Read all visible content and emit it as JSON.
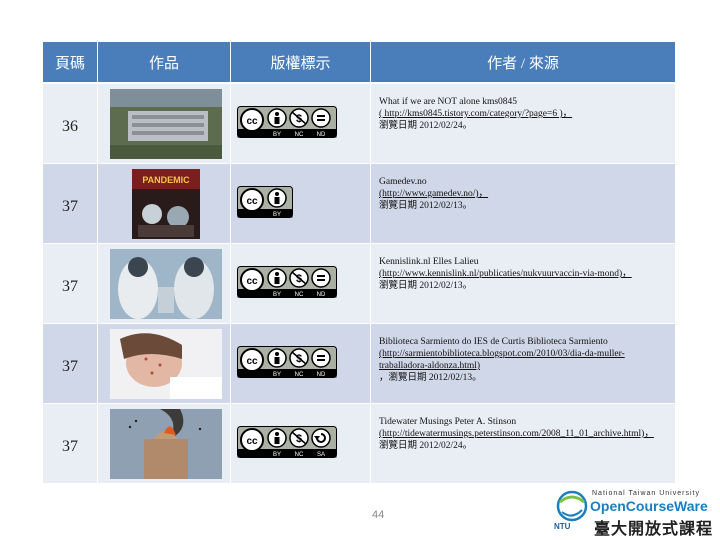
{
  "header": {
    "col_page": "頁碼",
    "col_work": "作品",
    "col_license": "版權標示",
    "col_source": "作者 / 來源"
  },
  "rows": [
    {
      "page": "36",
      "image": "aerial-facility-photo",
      "license": [
        "BY",
        "NC",
        "ND"
      ],
      "source_line1": "What if we are NOT alone kms0845",
      "source_link": "( http://kms0845.tistory.com/category/?page=6 )，",
      "source_date": "瀏覽日期 2012/02/24。"
    },
    {
      "page": "37",
      "image": "pandemic-game-cover",
      "license": [
        "BY"
      ],
      "source_line1": "Gamedev.no",
      "source_link": "(http://www.gamedev.no/)，",
      "source_date": "瀏覽日期 2012/02/13。"
    },
    {
      "page": "37",
      "image": "hazmat-suits-photo",
      "license": [
        "BY",
        "NC",
        "ND"
      ],
      "source_line1": "Kennislink.nl Elles Lalieu",
      "source_link": "(http://www.kennislink.nl/publicaties/nukvuurvaccin-via-mond)，",
      "source_date": "瀏覽日期 2012/02/13。"
    },
    {
      "page": "37",
      "image": "sick-woman-photo",
      "license": [
        "BY",
        "NC",
        "ND"
      ],
      "source_line1": "Biblioteca Sarmiento do IES de Curtis Biblioteca Sarmiento",
      "source_link": "(http://sarmientobiblioteca.blogspot.com/2010/03/dia-da-muller-traballadora-aldonza.html)",
      "source_date": "，瀏覽日期 2012/02/13。"
    },
    {
      "page": "37",
      "image": "burning-building-photo",
      "license": [
        "BY",
        "NC",
        "SA"
      ],
      "source_line1": "Tidewater Musings Peter A. Stinson",
      "source_link": "(http://tidewatermusings.peterstinson.com/2008_11_01_archive.html)，",
      "source_date": "瀏覽日期 2012/02/24。"
    }
  ],
  "footer": {
    "page_number": "44",
    "logo_line1": "National Taiwan University",
    "logo_line2": "OpenCourseWare",
    "logo_line3": "臺大開放式課程",
    "logo_ntu": "NTU"
  },
  "colors": {
    "header_bg": "#4a7ebb",
    "row_dark": "#cfd7e8",
    "row_light": "#e9edf4"
  }
}
